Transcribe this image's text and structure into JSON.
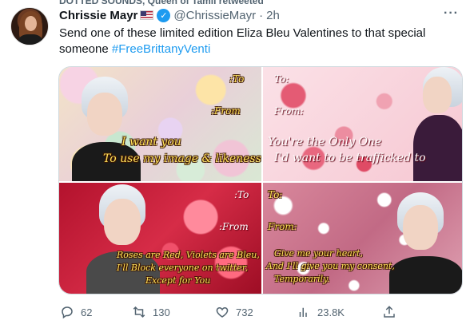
{
  "retweet_bar": {
    "text": "DOTTED SOUNDS, Queen of Tamil retweeted"
  },
  "tweet": {
    "display_name": "Chrissie Mayr",
    "handle": "@ChrissieMayr",
    "dot": "·",
    "time": "2h",
    "text_prefix": "Send one of these limited edition Eliza Bleu Valentines to that special someone ",
    "hashtag": "#FreeBrittanyVenti"
  },
  "cards": [
    {
      "to": ":To",
      "from": ":From",
      "line1": "I want you",
      "line2": "To use my image & likeness"
    },
    {
      "to": "To:",
      "from": "From:",
      "line1": "You're the Only One",
      "line2": "I'd want to be trafficked to"
    },
    {
      "to": ":To",
      "from": ":From",
      "line1": "Roses are Red, Violets are Bleu,",
      "line2": "I'll Block everyone on twitter,",
      "line3": "Except for You"
    },
    {
      "to": "To:",
      "from": "From:",
      "line1": "Give me your heart,",
      "line2": "And I'll give you my consent,",
      "line3": "Temporarily."
    }
  ],
  "actions": {
    "replies": "62",
    "retweets": "130",
    "likes": "732",
    "views": "23.8K"
  },
  "icons": [
    "more-icon",
    "verified-badge-icon",
    "us-flag-icon",
    "reply-icon",
    "retweet-icon",
    "like-icon",
    "views-icon",
    "share-icon"
  ],
  "colors": {
    "link": "#1d9bf0",
    "muted": "#536471",
    "text": "#0f1419"
  }
}
